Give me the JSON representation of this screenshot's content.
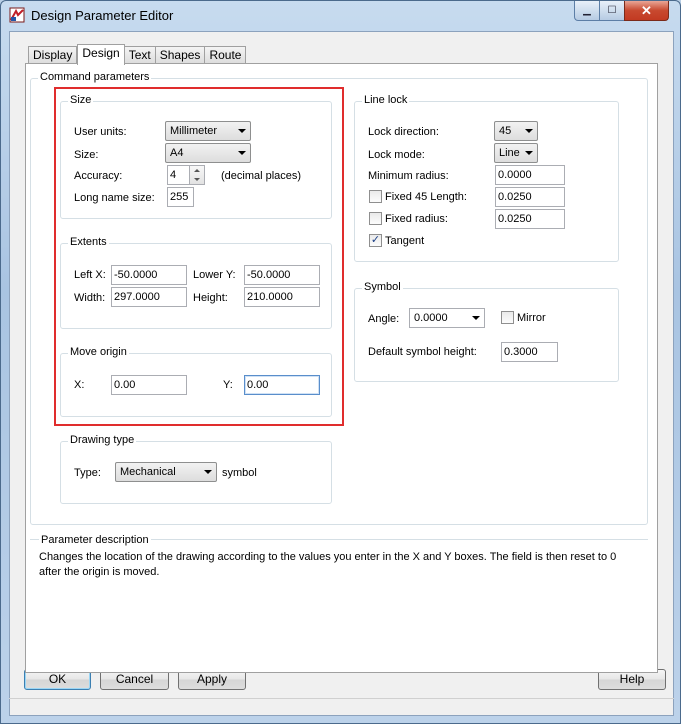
{
  "window": {
    "title": "Design Parameter Editor",
    "close_glyph": "✕",
    "minimize_glyph": "▁",
    "maximize_glyph": "☐"
  },
  "tabs": [
    {
      "label": "Display"
    },
    {
      "label": "Design",
      "active": true
    },
    {
      "label": "Text"
    },
    {
      "label": "Shapes"
    },
    {
      "label": "Route"
    }
  ],
  "command_parameters": {
    "title": "Command parameters",
    "size": {
      "title": "Size",
      "user_units_label": "User units:",
      "user_units_value": "Millimeter",
      "size_label": "Size:",
      "size_value": "A4",
      "accuracy_label": "Accuracy:",
      "accuracy_value": "4",
      "accuracy_suffix": "(decimal places)",
      "long_name_label": "Long name size:",
      "long_name_value": "255"
    },
    "extents": {
      "title": "Extents",
      "left_x_label": "Left X:",
      "left_x_value": "-50.0000",
      "lower_y_label": "Lower Y:",
      "lower_y_value": "-50.0000",
      "width_label": "Width:",
      "width_value": "297.0000",
      "height_label": "Height:",
      "height_value": "210.0000"
    },
    "move_origin": {
      "title": "Move origin",
      "x_label": "X:",
      "x_value": "0.00",
      "y_label": "Y:",
      "y_value": "0.00"
    },
    "drawing_type": {
      "title": "Drawing type",
      "type_label": "Type:",
      "type_value": "Mechanical",
      "suffix": "symbol"
    },
    "line_lock": {
      "title": "Line lock",
      "lock_direction_label": "Lock direction:",
      "lock_direction_value": "45",
      "lock_mode_label": "Lock mode:",
      "lock_mode_value": "Line",
      "min_radius_label": "Minimum radius:",
      "min_radius_value": "0.0000",
      "fixed45_label": "Fixed 45 Length:",
      "fixed45_value": "0.0250",
      "fixed45_checked": false,
      "fixed_radius_label": "Fixed radius:",
      "fixed_radius_value": "0.0250",
      "fixed_radius_checked": false,
      "tangent_label": "Tangent",
      "tangent_checked": true,
      "check_glyph": "✓"
    },
    "symbol": {
      "title": "Symbol",
      "angle_label": "Angle:",
      "angle_value": "0.0000",
      "mirror_label": "Mirror",
      "mirror_checked": false,
      "default_height_label": "Default symbol height:",
      "default_height_value": "0.3000"
    }
  },
  "parameter_description": {
    "title": "Parameter description",
    "text": "Changes the location of the drawing according to the values you enter in the X and Y boxes. The field is then reset to 0 after the origin is moved."
  },
  "buttons": {
    "ok": "OK",
    "cancel": "Cancel",
    "apply": "Apply",
    "help": "Help"
  },
  "colors": {
    "highlight_border": "#e02d2d",
    "tangent_check": "#1b3f86"
  }
}
